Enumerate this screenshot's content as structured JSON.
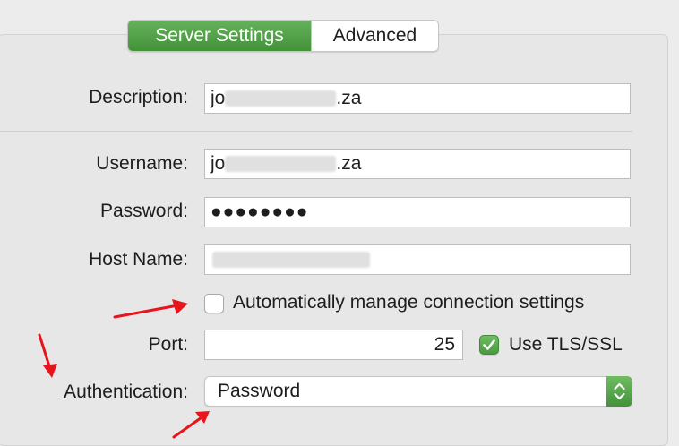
{
  "tabs": [
    {
      "label": "Server Settings",
      "active": true
    },
    {
      "label": "Advanced",
      "active": false
    }
  ],
  "form": {
    "description": {
      "label": "Description:",
      "value_prefix": "jo",
      "value_suffix": ".za"
    },
    "username": {
      "label": "Username:",
      "value_prefix": "jo",
      "value_suffix": ".za"
    },
    "password": {
      "label": "Password:",
      "value": "●●●●●●●●"
    },
    "host_name": {
      "label": "Host Name:",
      "value": ""
    },
    "auto_manage": {
      "label": "Automatically manage connection settings",
      "checked": false
    },
    "port": {
      "label": "Port:",
      "value": "25"
    },
    "use_tls": {
      "label": "Use TLS/SSL",
      "checked": true
    },
    "authentication": {
      "label": "Authentication:",
      "value": "Password"
    }
  },
  "icons": {
    "checkmark": "checkmark-icon",
    "stepper": "chevron-updown-icon",
    "annotation": "arrow-icon"
  },
  "colors": {
    "accent": "#4a9a40",
    "annotation": "#e8141c"
  }
}
